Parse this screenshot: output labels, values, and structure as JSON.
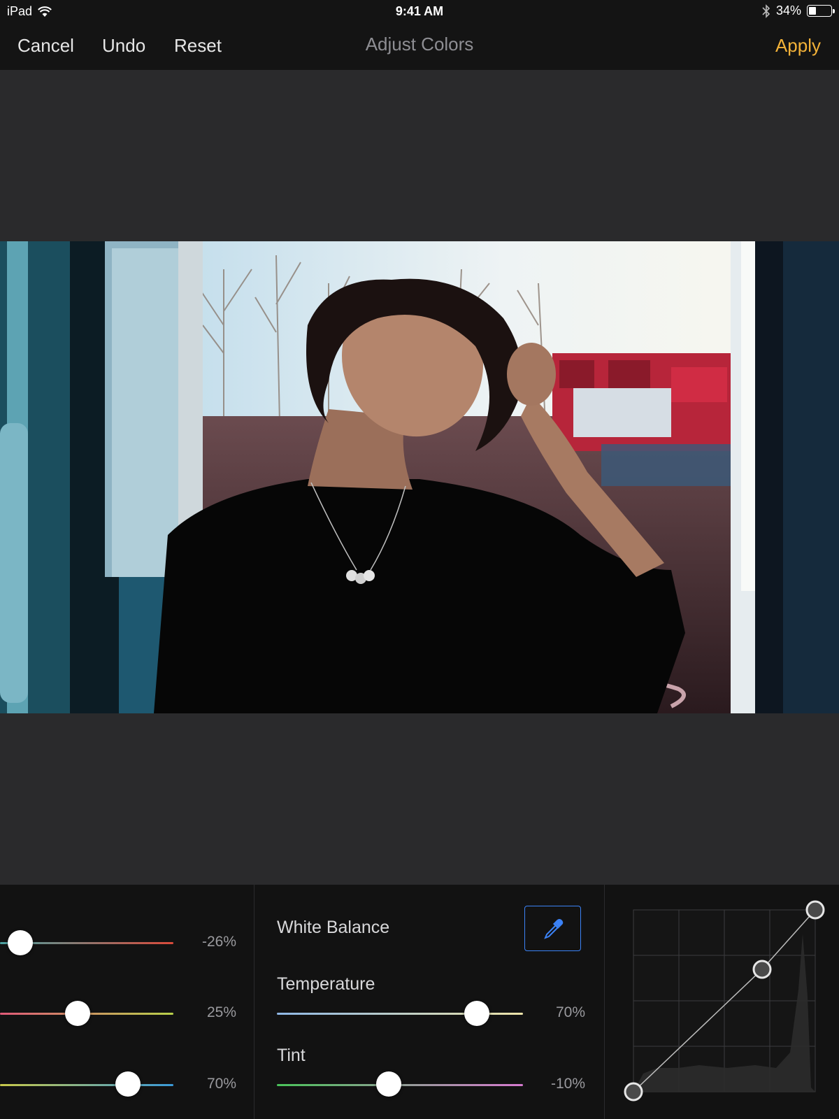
{
  "status": {
    "device": "iPad",
    "time": "9:41 AM",
    "battery": "34%",
    "battery_level": 0.34
  },
  "nav": {
    "cancel": "Cancel",
    "undo": "Undo",
    "reset": "Reset",
    "title": "Adjust Colors",
    "apply": "Apply"
  },
  "left_sliders": [
    {
      "value": "-26%"
    },
    {
      "value": "25%"
    },
    {
      "value": "70%"
    }
  ],
  "white_balance": {
    "title": "White Balance",
    "temperature": {
      "label": "Temperature",
      "value": "70%"
    },
    "tint": {
      "label": "Tint",
      "value": "-10%"
    }
  },
  "colors": {
    "accent": "#f3b238",
    "picker": "#3b82f6"
  },
  "icons": [
    "wifi-icon",
    "bluetooth-icon",
    "battery-icon",
    "eyedropper-icon"
  ]
}
